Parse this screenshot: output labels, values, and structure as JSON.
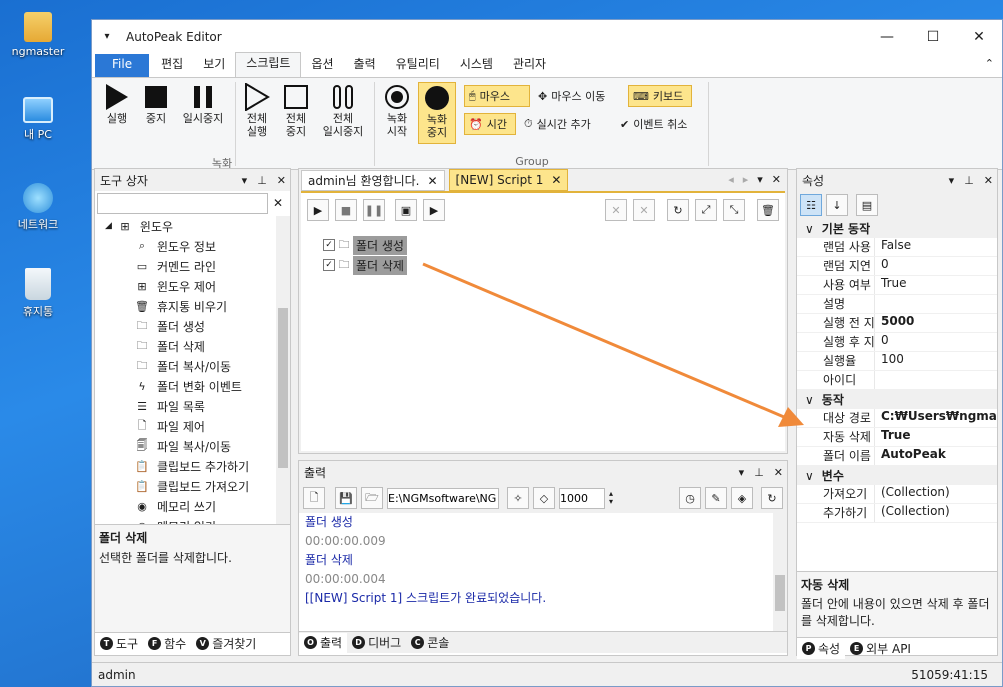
{
  "desktop": {
    "icons": [
      {
        "label": "ngmaster"
      },
      {
        "label": "내 PC"
      },
      {
        "label": "네트워크"
      },
      {
        "label": "휴지통"
      }
    ]
  },
  "window": {
    "title": "AutoPeak Editor",
    "status_user": "admin",
    "status_time": "51059:41:15"
  },
  "menu": {
    "items": [
      "File",
      "편집",
      "보기",
      "스크립트",
      "옵션",
      "출력",
      "유틸리티",
      "시스템",
      "관리자"
    ],
    "active": "스크립트"
  },
  "ribbon": {
    "record_group_label": "녹화",
    "group_group_label": "Group",
    "run": "실행",
    "stop": "중지",
    "pause": "일시중지",
    "run_all": "전체\n실행",
    "stop_all": "전체\n중지",
    "pause_all": "전체\n일시중지",
    "rec_start": "녹화\n시작",
    "rec_stop": "녹화\n중지",
    "mouse": "마우스",
    "mouse_move": "마우스 이동",
    "keyboard": "키보드",
    "time": "시간",
    "realtime_add": "실시간 추가",
    "event_cancel": "이벤트 취소"
  },
  "toolbox": {
    "title": "도구 상자",
    "search_value": "",
    "root": "윈도우",
    "items": [
      "윈도우 정보",
      "커멘드 라인",
      "윈도우 제어",
      "휴지통 비우기",
      "폴더 생성",
      "폴더 삭제",
      "폴더 복사/이동",
      "폴더 변화 이벤트",
      "파일 목록",
      "파일 제어",
      "파일 복사/이동",
      "클립보드 추가하기",
      "클립보드 가져오기",
      "메모리 쓰기",
      "메모리 읽기"
    ],
    "desc_title": "폴더 삭제",
    "desc_text": "선택한 폴더를 삭제합니다.",
    "tabs": [
      "도구",
      "함수",
      "즐겨찾기"
    ]
  },
  "editor": {
    "tabs": [
      "admin님 환영합니다.",
      "[NEW] Script 1"
    ],
    "nodes": [
      "폴더 생성",
      "폴더 삭제"
    ]
  },
  "output": {
    "title": "출력",
    "path": "E:\\NGMsoftware\\NG",
    "count": "1000",
    "lines": [
      {
        "text": "폴더 생성",
        "color": "#1b2aa8"
      },
      {
        "text": "00:00:00.009",
        "color": "#888888"
      },
      {
        "text": "폴더 삭제",
        "color": "#1b2aa8"
      },
      {
        "text": "00:00:00.004",
        "color": "#888888"
      },
      {
        "text": "[[NEW] Script 1] 스크립트가 완료되었습니다.",
        "color": "#1b2aa8"
      }
    ],
    "tabs": [
      "출력",
      "디버그",
      "콘솔"
    ]
  },
  "props": {
    "title": "속성",
    "cat1": "기본 동작",
    "cat2": "동작",
    "cat3": "변수",
    "basic": [
      {
        "k": "랜덤 사용",
        "v": "False"
      },
      {
        "k": "랜덤 지연",
        "v": "0"
      },
      {
        "k": "사용 여부",
        "v": "True"
      },
      {
        "k": "설명",
        "v": ""
      },
      {
        "k": "실행 전 지",
        "v": "5000"
      },
      {
        "k": "실행 후 지",
        "v": "0"
      },
      {
        "k": "실행율",
        "v": "100"
      },
      {
        "k": "아이디",
        "v": ""
      }
    ],
    "action": [
      {
        "k": "대상 경로",
        "v": "C:₩Users₩ngmaster"
      },
      {
        "k": "자동 삭제",
        "v": "True"
      },
      {
        "k": "폴더 이름",
        "v": "AutoPeak"
      }
    ],
    "vars": [
      {
        "k": "가져오기",
        "v": "(Collection)"
      },
      {
        "k": "추가하기",
        "v": "(Collection)"
      }
    ],
    "desc_title": "자동 삭제",
    "desc_text": "폴더 안에 내용이 있으면 삭제 후 폴더를 삭제합니다.",
    "tabs": [
      "속성",
      "외부 API"
    ]
  }
}
